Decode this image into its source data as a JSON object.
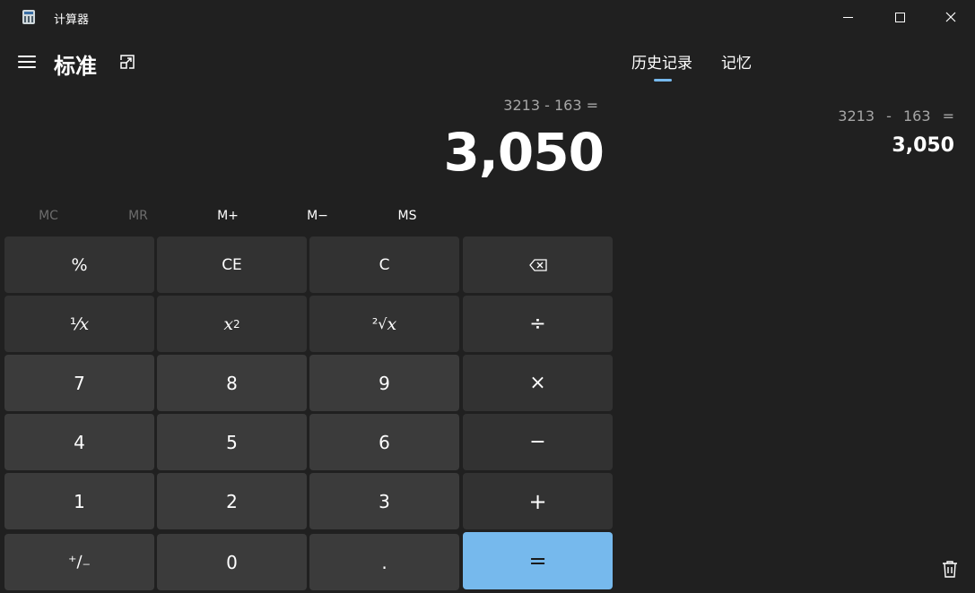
{
  "window": {
    "title": "计算器",
    "controls": {
      "minimize_icon": "minimize-icon",
      "maximize_icon": "maximize-icon",
      "close_icon": "close-icon"
    }
  },
  "header": {
    "menu_icon": "hamburger-menu-icon",
    "mode_title": "标准",
    "keep_on_top_icon": "keep-on-top-icon"
  },
  "display": {
    "expression": "3213 - 163 =",
    "result": "3,050"
  },
  "memory_buttons": [
    {
      "label": "MC",
      "enabled": false
    },
    {
      "label": "MR",
      "enabled": false
    },
    {
      "label": "M+",
      "enabled": true
    },
    {
      "label": "M−",
      "enabled": true
    },
    {
      "label": "MS",
      "enabled": true
    }
  ],
  "keypad": {
    "percent": "%",
    "clear_entry": "CE",
    "clear": "C",
    "backspace_icon": "backspace-icon",
    "reciprocal_pre": "⅟",
    "reciprocal_var": "x",
    "square_var": "x",
    "square_sup": "2",
    "sqrt_pre": "²√",
    "sqrt_var": "x",
    "divide": "÷",
    "seven": "7",
    "eight": "8",
    "nine": "9",
    "multiply": "×",
    "four": "4",
    "five": "5",
    "six": "6",
    "subtract": "−",
    "one": "1",
    "two": "2",
    "three": "3",
    "add": "+",
    "negate": "⁺∕₋",
    "zero": "0",
    "decimal": ".",
    "equals": "="
  },
  "side_panel": {
    "tabs": [
      "历史记录",
      "记忆"
    ],
    "active_tab": "历史记录",
    "history": [
      {
        "expression": "3213 - 163 =",
        "result": "3,050"
      }
    ],
    "trash_icon": "delete-history-icon"
  },
  "colors": {
    "background": "#202020",
    "function_key": "#323232",
    "number_key": "#3b3b3b",
    "accent": "#76b9ed",
    "muted_text": "#a6a6a6",
    "disabled_text": "#6d6d6d"
  }
}
